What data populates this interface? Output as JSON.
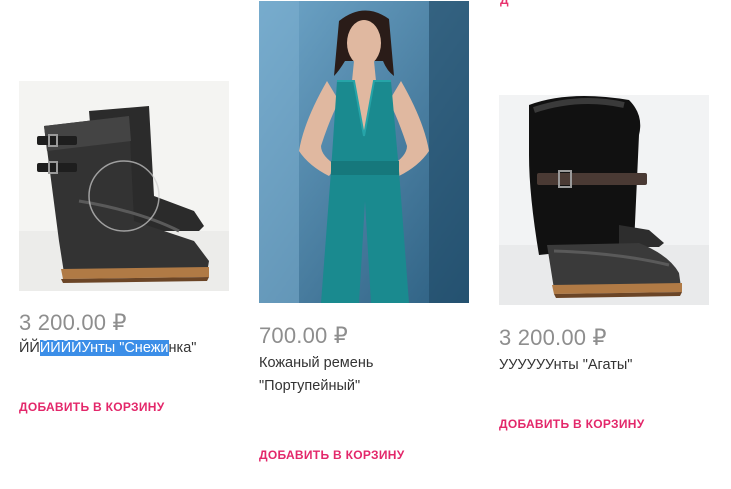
{
  "products": [
    {
      "image_name": "boots-snezhinka-image",
      "price": "3 200.00 ₽",
      "title_parts": [
        "ЙЙ",
        "ЙЙЙЙУнты \"Снежи",
        "нка\""
      ],
      "add_to_cart_label": "ДОБАВИТЬ В КОРЗИНУ"
    },
    {
      "image_name": "belt-model-image",
      "price": "700.00 ₽",
      "title_line1": "Кожаный ремень",
      "title_line2": "\"Портупейный\"",
      "add_to_cart_label": "ДОБАВИТЬ В КОРЗИНУ"
    },
    {
      "image_name": "boots-agaty-image",
      "price": "3 200.00 ₽",
      "title": "УУУУУУнты \"Агаты\"",
      "add_to_cart_label": "ДОБАВИТЬ В КОРЗИНУ"
    }
  ],
  "top_fragment": "Д",
  "colors": {
    "price": "#8e8e8e",
    "button": "#e3276a",
    "selection": "#3b8ee8"
  }
}
